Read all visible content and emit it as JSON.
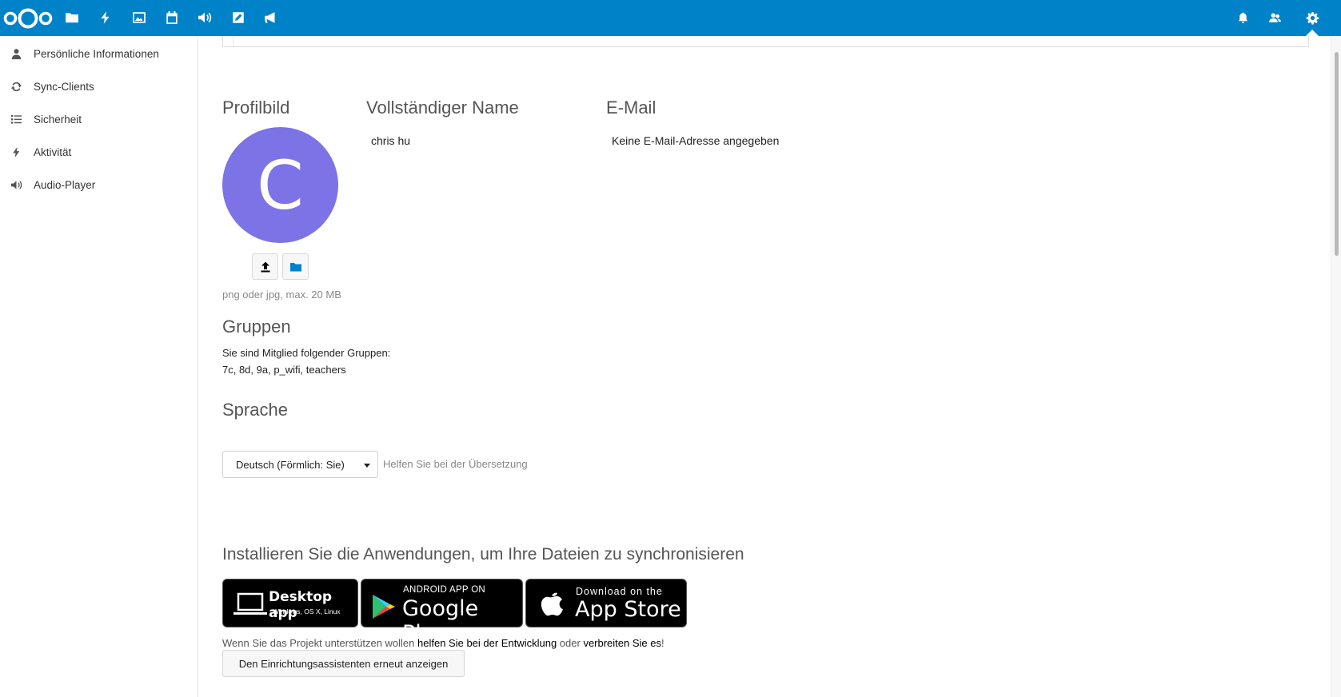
{
  "header": {
    "logo": "nextcloud-logo",
    "apps": [
      "files-icon",
      "activity-icon",
      "gallery-icon",
      "calendar-icon",
      "audio-icon",
      "notes-icon",
      "announcements-icon"
    ],
    "right": [
      "notifications-icon",
      "contacts-icon",
      "settings-icon"
    ]
  },
  "sidebar": {
    "items": [
      {
        "label": "Persönliche Informationen",
        "icon": "user-icon"
      },
      {
        "label": "Sync-Clients",
        "icon": "sync-icon"
      },
      {
        "label": "Sicherheit",
        "icon": "list-icon"
      },
      {
        "label": "Aktivität",
        "icon": "activity-icon"
      },
      {
        "label": "Audio-Player",
        "icon": "speaker-icon"
      }
    ]
  },
  "profile": {
    "avatar_title": "Profilbild",
    "avatar_letter": "C",
    "avatar_color": "#7b73e6",
    "avatar_hint": "png oder jpg, max. 20 MB",
    "name_title": "Vollständiger Name",
    "name_value": "chris hu",
    "email_title": "E-Mail",
    "email_value": "Keine E-Mail-Adresse angegeben"
  },
  "groups": {
    "title": "Gruppen",
    "intro": "Sie sind Mitglied folgender Gruppen:",
    "list": "7c, 8d, 9a, p_wifi, teachers"
  },
  "language": {
    "title": "Sprache",
    "selected": "Deutsch (Förmlich: Sie)",
    "help_link": "Helfen Sie bei der Übersetzung"
  },
  "apps": {
    "title": "Installieren Sie die Anwendungen, um Ihre Dateien zu synchronisieren",
    "desktop": {
      "main": "Desktop app",
      "sub": "Windows, OS X, Linux"
    },
    "android": {
      "top": "ANDROID APP ON",
      "main": "Google Play"
    },
    "ios": {
      "top": "Download on the",
      "main": "App Store"
    },
    "support_prefix": "Wenn Sie das Projekt unterstützen wollen ",
    "support_link1": "helfen Sie bei der Entwicklung",
    "support_mid": " oder ",
    "support_link2": "verbreiten Sie es",
    "support_suffix": "!",
    "wizard_button": "Den Einrichtungsassistenten erneut anzeigen"
  },
  "colors": {
    "header": "#0082c9",
    "accent": "#0082c9"
  }
}
